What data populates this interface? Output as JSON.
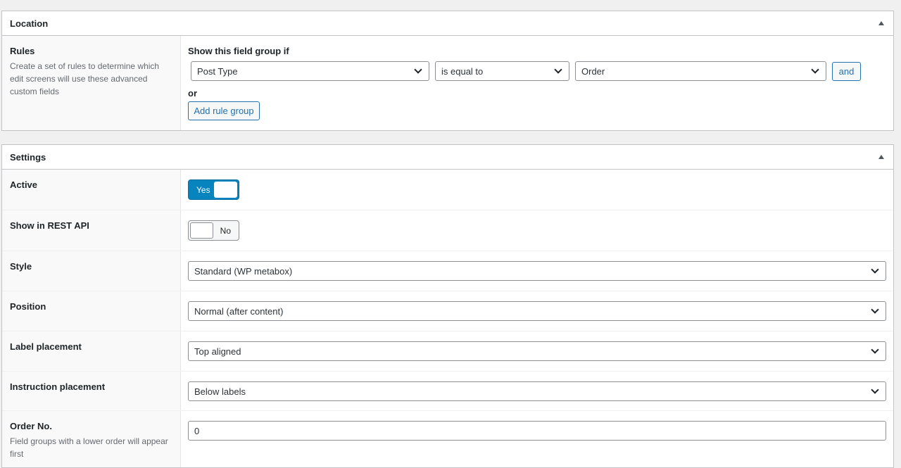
{
  "location": {
    "title": "Location",
    "rules_label": "Rules",
    "rules_description": "Create a set of rules to determine which edit screens will use these advanced custom fields",
    "show_if_label": "Show this field group if",
    "rule": {
      "param": "Post Type",
      "operator": "is equal to",
      "value": "Order"
    },
    "and_label": "and",
    "or_label": "or",
    "add_rule_group_label": "Add rule group"
  },
  "settings": {
    "title": "Settings",
    "active": {
      "label": "Active",
      "state": "Yes"
    },
    "rest_api": {
      "label": "Show in REST API",
      "state": "No"
    },
    "style": {
      "label": "Style",
      "value": "Standard (WP metabox)"
    },
    "position": {
      "label": "Position",
      "value": "Normal (after content)"
    },
    "label_placement": {
      "label": "Label placement",
      "value": "Top aligned"
    },
    "instruction_placement": {
      "label": "Instruction placement",
      "value": "Below labels"
    },
    "order_no": {
      "label": "Order No.",
      "description": "Field groups with a lower order will appear first",
      "value": "0"
    }
  },
  "colors": {
    "accent": "#2271b1",
    "switch_on": "#0783be",
    "border": "#c3c4c7",
    "background": "#f0f0f1"
  },
  "icons": {
    "collapse": "triangle-up-icon",
    "dropdown": "chevron-down-icon"
  }
}
